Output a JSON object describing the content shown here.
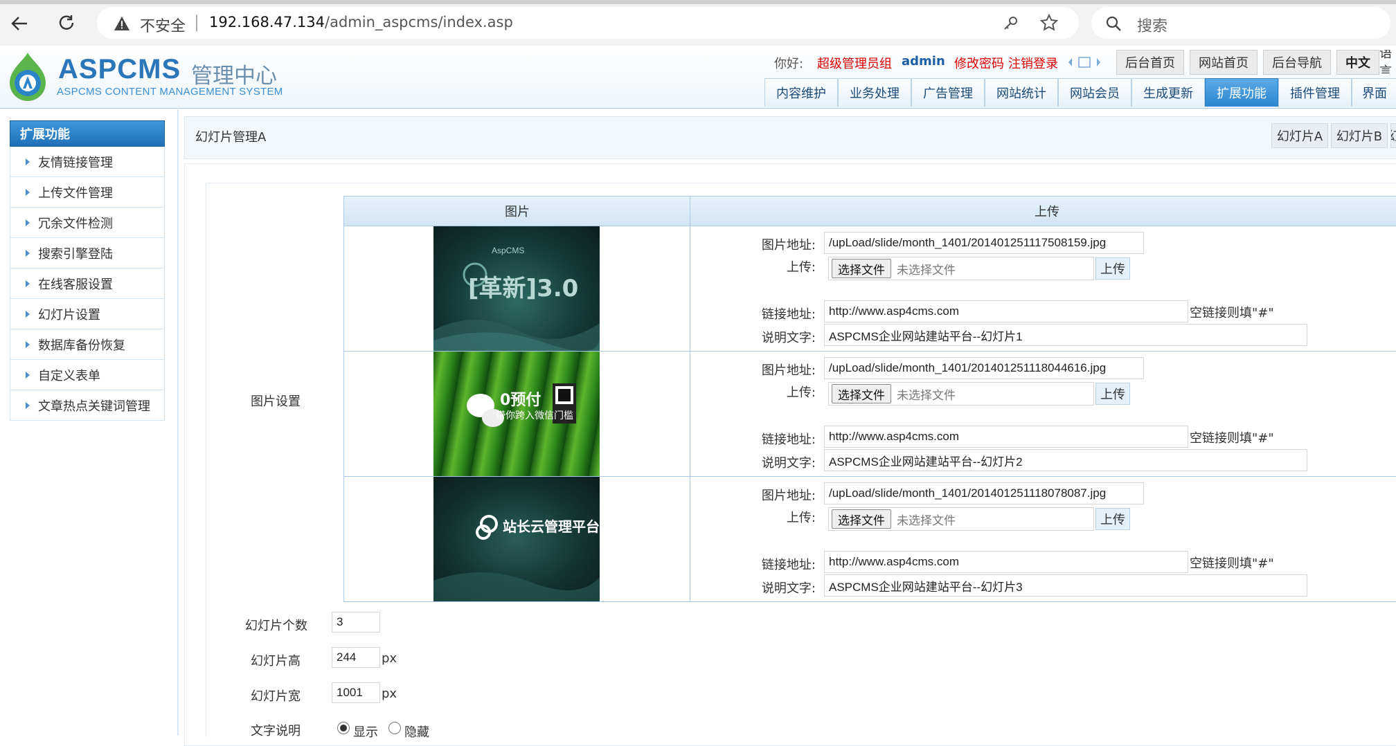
{
  "browser": {
    "insecure_label": "不安全",
    "url_host": "192.168.47.134",
    "url_path": "/admin_aspcms/index.asp",
    "search_placeholder": "搜索"
  },
  "header": {
    "logo_main": "ASPCMS",
    "logo_cn": "管理中心",
    "logo_sub": "ASPCMS CONTENT MANAGEMENT SYSTEM",
    "greeting": "你好:",
    "role": "超级管理员组",
    "username": "admin",
    "change_password": "修改密码",
    "logout": "注销登录",
    "quick_links": [
      "后台首页",
      "网站首页",
      "后台导航",
      "中文",
      "语言"
    ],
    "tabs": [
      "内容维护",
      "业务处理",
      "广告管理",
      "网站统计",
      "网站会员",
      "生成更新",
      "扩展功能",
      "插件管理",
      "界面"
    ],
    "active_tab": "扩展功能"
  },
  "sidebar": {
    "title": "扩展功能",
    "items": [
      "友情链接管理",
      "上传文件管理",
      "冗余文件检测",
      "搜索引擎登陆",
      "在线客服设置",
      "幻灯片设置",
      "数据库备份恢复",
      "自定义表单",
      "文章热点关键词管理"
    ]
  },
  "content": {
    "title": "幻灯片管理A",
    "slide_tabs": [
      "幻灯片A",
      "幻灯片B",
      "幻"
    ],
    "section_label": "图片设置",
    "grid_headers": [
      "图片",
      "上传"
    ],
    "labels": {
      "image_url": "图片地址:",
      "upload": "上传:",
      "link_url": "链接地址:",
      "desc": "说明文字:",
      "choose_file": "选择文件",
      "no_file": "未选择文件",
      "upload_btn": "上传",
      "empty_link_hint": "空链接则填\"#\""
    },
    "slides": [
      {
        "image_url": "/upLoad/slide/month_1401/201401251117508159.jpg",
        "link": "http://www.asp4cms.com",
        "desc": "ASPCMS企业网站建站平台--幻灯片1",
        "thumb_text": "[革新]3.0",
        "thumb_brand": "AspCMS"
      },
      {
        "image_url": "/upLoad/slide/month_1401/201401251118044616.jpg",
        "link": "http://www.asp4cms.com",
        "desc": "ASPCMS企业网站建站平台--幻灯片2",
        "thumb_text": "0预付",
        "thumb_sub": "带你跨入微信门槛"
      },
      {
        "image_url": "/upLoad/slide/month_1401/201401251118078087.jpg",
        "link": "http://www.asp4cms.com",
        "desc": "ASPCMS企业网站建站平台--幻灯片3",
        "thumb_text": "站长云管理平台"
      }
    ],
    "settings": {
      "count_label": "幻灯片个数",
      "count": "3",
      "height_label": "幻灯片高",
      "height": "244",
      "width_label": "幻灯片宽",
      "width": "1001",
      "unit": "px",
      "text_label": "文字说明",
      "show": "显示",
      "hide": "隐藏"
    }
  },
  "colors": {
    "accent": "#2d86cf",
    "red_link": "#dd0000",
    "border": "#a9c9e6"
  }
}
